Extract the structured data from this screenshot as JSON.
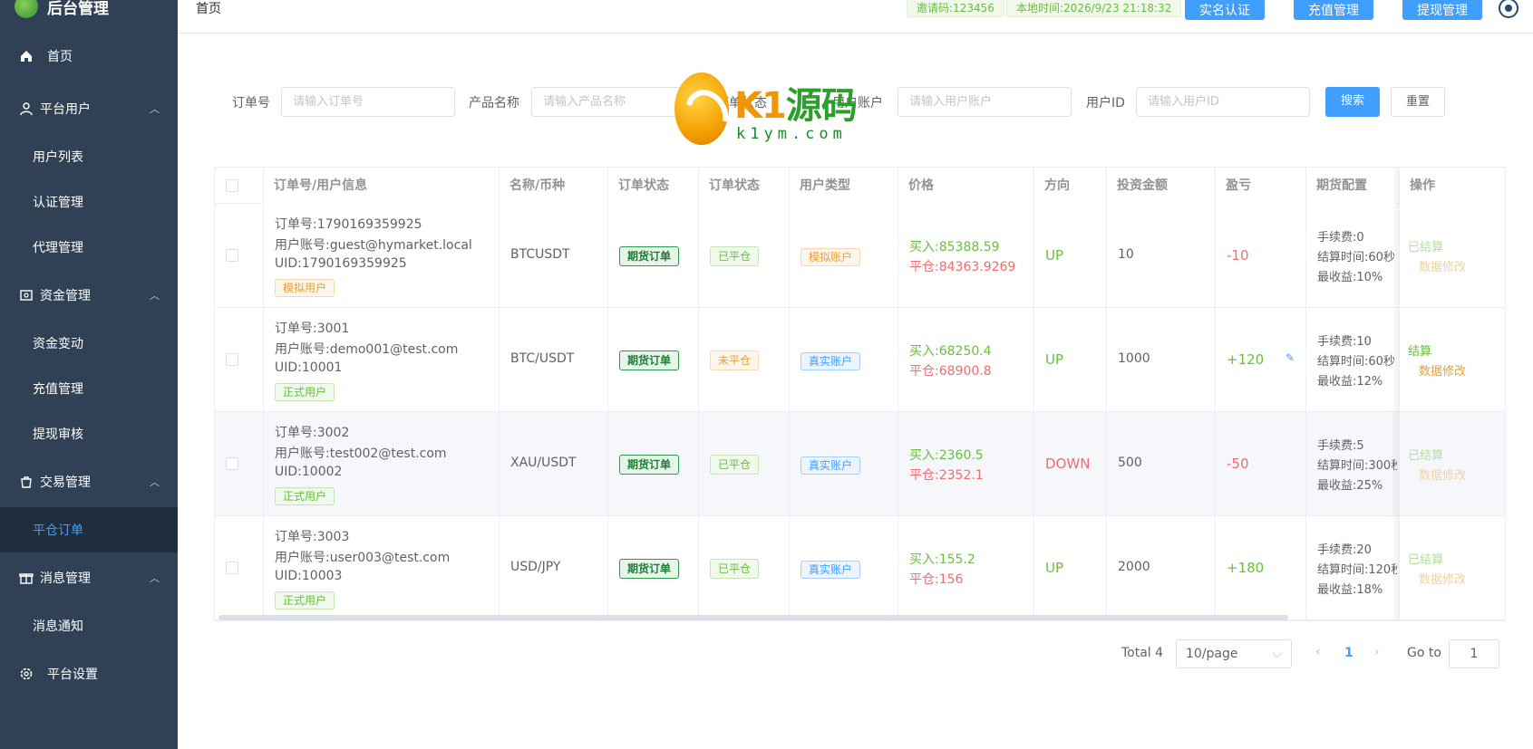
{
  "app": {
    "title": "后台管理"
  },
  "sidebar": {
    "items": [
      {
        "label": "首页",
        "icon": "home-icon"
      },
      {
        "label": "平台用户",
        "icon": "user-icon",
        "children": [
          "用户列表",
          "认证管理",
          "代理管理"
        ]
      },
      {
        "label": "资金管理",
        "icon": "wallet-icon",
        "children": [
          "资金变动",
          "充值管理",
          "提现审核"
        ]
      },
      {
        "label": "交易管理",
        "icon": "shopping-bag-icon",
        "children": [
          "平仓订单"
        ]
      },
      {
        "label": "消息管理",
        "icon": "gift-icon",
        "children": [
          "消息通知"
        ]
      },
      {
        "label": "平台设置",
        "icon": "gear-icon"
      }
    ],
    "active": "平仓订单"
  },
  "topbar": {
    "breadcrumb": "首页",
    "invite": "邀请码:123456",
    "local_time": "本地时间:2026/9/23 21:18:32",
    "buttons": [
      "实名认证",
      "充值管理",
      "提现管理"
    ]
  },
  "search": {
    "order_label": "订单号",
    "order_placeholder": "请输入订单号",
    "product_label": "产品名称",
    "product_placeholder": "请输入产品名称",
    "status_label": "订单状态",
    "account_label": "用户账户",
    "account_placeholder": "请输入用户账户",
    "uid_label": "用户ID",
    "uid_placeholder": "请输入用户ID",
    "search_btn": "搜索",
    "reset_btn": "重置"
  },
  "watermark": {
    "brand": "K1源码",
    "brand_k": "K1",
    "brand_cn": "源码",
    "domain": "k1ym.com"
  },
  "table": {
    "headers": [
      "订单号/用户信息",
      "名称/币种",
      "订单状态",
      "订单状态",
      "用户类型",
      "价格",
      "方向",
      "投资金额",
      "盈亏",
      "期货配置",
      "操作"
    ],
    "rows": [
      {
        "order": "订单号:1790169359925",
        "account": "用户账号:guest@hymarket.local",
        "uid": "UID:1790169359925",
        "user_tag": "模拟用户",
        "symbol": "BTCUSDT",
        "type": "期货订单",
        "status": "已平仓",
        "account_type": "模拟账户",
        "buy": "买入:85388.59",
        "close": "平仓:84363.9269",
        "direction": "UP",
        "amount": "10",
        "pnl": "-10",
        "fee": "手续费:0",
        "settle": "结算时间:60秒",
        "min_return": "最收益:10%",
        "op1": "已结算",
        "op2": "数据修改"
      },
      {
        "order": "订单号:3001",
        "account": "用户账号:demo001@test.com",
        "uid": "UID:10001",
        "user_tag": "正式用户",
        "symbol": "BTC/USDT",
        "type": "期货订单",
        "status": "未平仓",
        "account_type": "真实账户",
        "buy": "买入:68250.4",
        "close": "平仓:68900.8",
        "direction": "UP",
        "amount": "1000",
        "pnl": "+120",
        "fee": "手续费:10",
        "settle": "结算时间:60秒",
        "min_return": "最收益:12%",
        "op1": "结算",
        "op2": "数据修改"
      },
      {
        "order": "订单号:3002",
        "account": "用户账号:test002@test.com",
        "uid": "UID:10002",
        "user_tag": "正式用户",
        "symbol": "XAU/USDT",
        "type": "期货订单",
        "status": "已平仓",
        "account_type": "真实账户",
        "buy": "买入:2360.5",
        "close": "平仓:2352.1",
        "direction": "DOWN",
        "amount": "500",
        "pnl": "-50",
        "fee": "手续费:5",
        "settle": "结算时间:300秒",
        "min_return": "最收益:25%",
        "op1": "已结算",
        "op2": "数据修改"
      },
      {
        "order": "订单号:3003",
        "account": "用户账号:user003@test.com",
        "uid": "UID:10003",
        "user_tag": "正式用户",
        "symbol": "USD/JPY",
        "type": "期货订单",
        "status": "已平仓",
        "account_type": "真实账户",
        "buy": "买入:155.2",
        "close": "平仓:156",
        "direction": "UP",
        "amount": "2000",
        "pnl": "+180",
        "fee": "手续费:20",
        "settle": "结算时间:120秒",
        "min_return": "最收益:18%",
        "op1": "已结算",
        "op2": "数据修改"
      }
    ]
  },
  "pager": {
    "total": "Total 4",
    "page_size": "10/page",
    "current": "1",
    "goto_label": "Go to",
    "goto_value": "1"
  },
  "colors": {
    "sidebar_bg": "#304156",
    "primary": "#409eff",
    "success": "#67c23a",
    "danger": "#f56c6c",
    "warning": "#e6a23c"
  }
}
